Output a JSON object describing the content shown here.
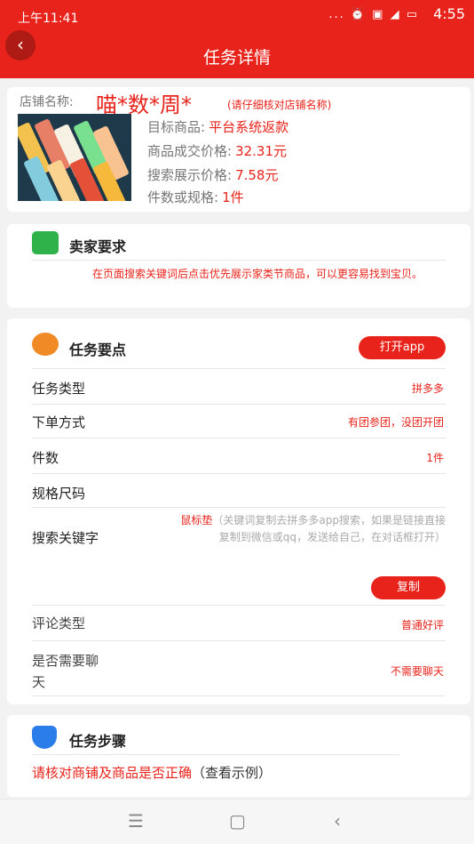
{
  "status_bar": {
    "time": "上午11:41",
    "icons": "... ⏰ ▣ ◢ ▭",
    "clock": "4:55"
  },
  "app_bar": {
    "back": "‹",
    "title": "任务详情"
  },
  "store": {
    "label": "店铺名称:",
    "name": "喵*数*周*",
    "hint": "(请仔细核对店铺名称)",
    "rows": [
      {
        "label": "目标商品:",
        "value": "平台系统返款"
      },
      {
        "label": "商品成交价格:",
        "value": "32.31元"
      },
      {
        "label": "搜索展示价格:",
        "value": "7.58元"
      },
      {
        "label": "件数或规格:",
        "value": "1件"
      }
    ]
  },
  "seller": {
    "title": "卖家要求",
    "text": "在页面搜索关键词后点击优先展示家类节商品，可以更容易找到宝贝。"
  },
  "points": {
    "title": "任务要点",
    "open_app": "打开app",
    "task_type_label": "任务类型",
    "task_type_value": "拼多多",
    "order_method_label": "下单方式",
    "order_method_value": "有团参团，没团开团",
    "quantity_label": "件数",
    "quantity_value": "1件",
    "spec_label": "规格尺码",
    "spec_value": "",
    "keyword_label": "搜索关键字",
    "keyword": "鼠标垫",
    "keyword_note": "（关键词复制去拼多多app搜索，如果是链接直接复制到微信或qq，发送给自己，在对话框打开）",
    "copy": "复制",
    "comment_label": "评论类型",
    "comment_value": "普通好评",
    "chat_label_1": "是否需要聊",
    "chat_label_2": "天",
    "chat_value": "不需要聊天"
  },
  "steps": {
    "title": "任务步骤",
    "text": "请核对商铺及商品是否正确",
    "example": "（查看示例）"
  },
  "nav": {
    "menu": "☰",
    "home": "▢",
    "back": "‹"
  },
  "colors": {
    "accent": "#e8231b"
  }
}
